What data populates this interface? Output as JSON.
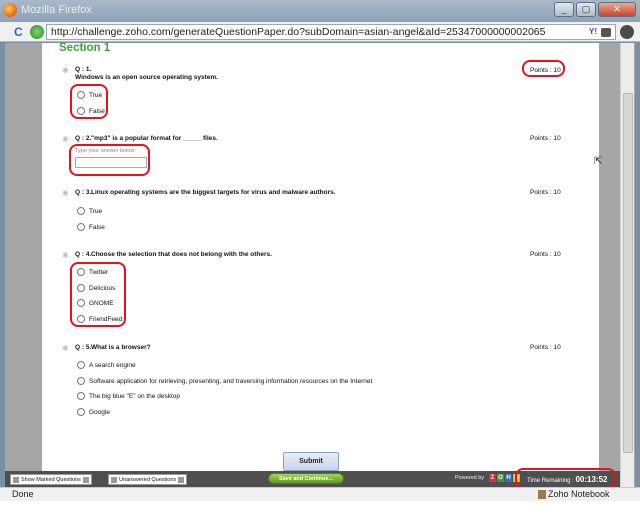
{
  "window": {
    "title": "Mozilla Firefox",
    "buttons": [
      "_",
      "▢",
      "✕"
    ]
  },
  "nav": {
    "url": "http://challenge.zoho.com/generateQuestionPaper.do?subDomain=asian-angel&aId=25347000000002065",
    "reload_glyph": "C",
    "ext_label": "Y!"
  },
  "section": {
    "title": "Section 1"
  },
  "questions": [
    {
      "num": "Q : 1.",
      "text": "Windows is an open source operating system.",
      "points": "Points : 10",
      "options": [
        "True",
        "False"
      ]
    },
    {
      "num": "Q : 2.",
      "text": "\"mp3\" is a popular format for _____ files.",
      "points": "Points : 10",
      "answer_label": "Type your answer below:"
    },
    {
      "num": "Q : 3.",
      "text": "Linux operating systems are the biggest targets for virus and malware authors.",
      "points": "Points : 10",
      "options": [
        "True",
        "False"
      ]
    },
    {
      "num": "Q : 4.",
      "text": "Choose the selection that does not belong with the others.",
      "points": "Points : 10",
      "options": [
        "Twitter",
        "Delicious",
        "GNOME",
        "FriendFeed"
      ]
    },
    {
      "num": "Q : 5.",
      "text": "What is a browser?",
      "points": "Points : 10",
      "options": [
        "A search engine",
        "Software application for retrieving, presenting, and traversing information resources on the Internet",
        "The big blue \"E\" on the desktop",
        "Google"
      ]
    }
  ],
  "submit_label": "Submit",
  "bottom_bar": {
    "show_marked": "Show Marked Questions",
    "unanswered": "Unanswered Questions",
    "save_continue": "Save and Continue...",
    "powered_by": "Powered by",
    "zoho_letters": [
      "Z",
      "O",
      "H",
      "O"
    ],
    "zoho_colors": [
      "#e32b2b",
      "#3b9b3b",
      "#2d6fcc",
      "#f0b323"
    ],
    "time_label": "Time Remaining :",
    "time_value": "00:13:52"
  },
  "status": {
    "text": "Done",
    "notebook": "Zoho Notebook"
  },
  "colors": {
    "section_green": "#39a635",
    "highlight_red": "#e8121c"
  }
}
